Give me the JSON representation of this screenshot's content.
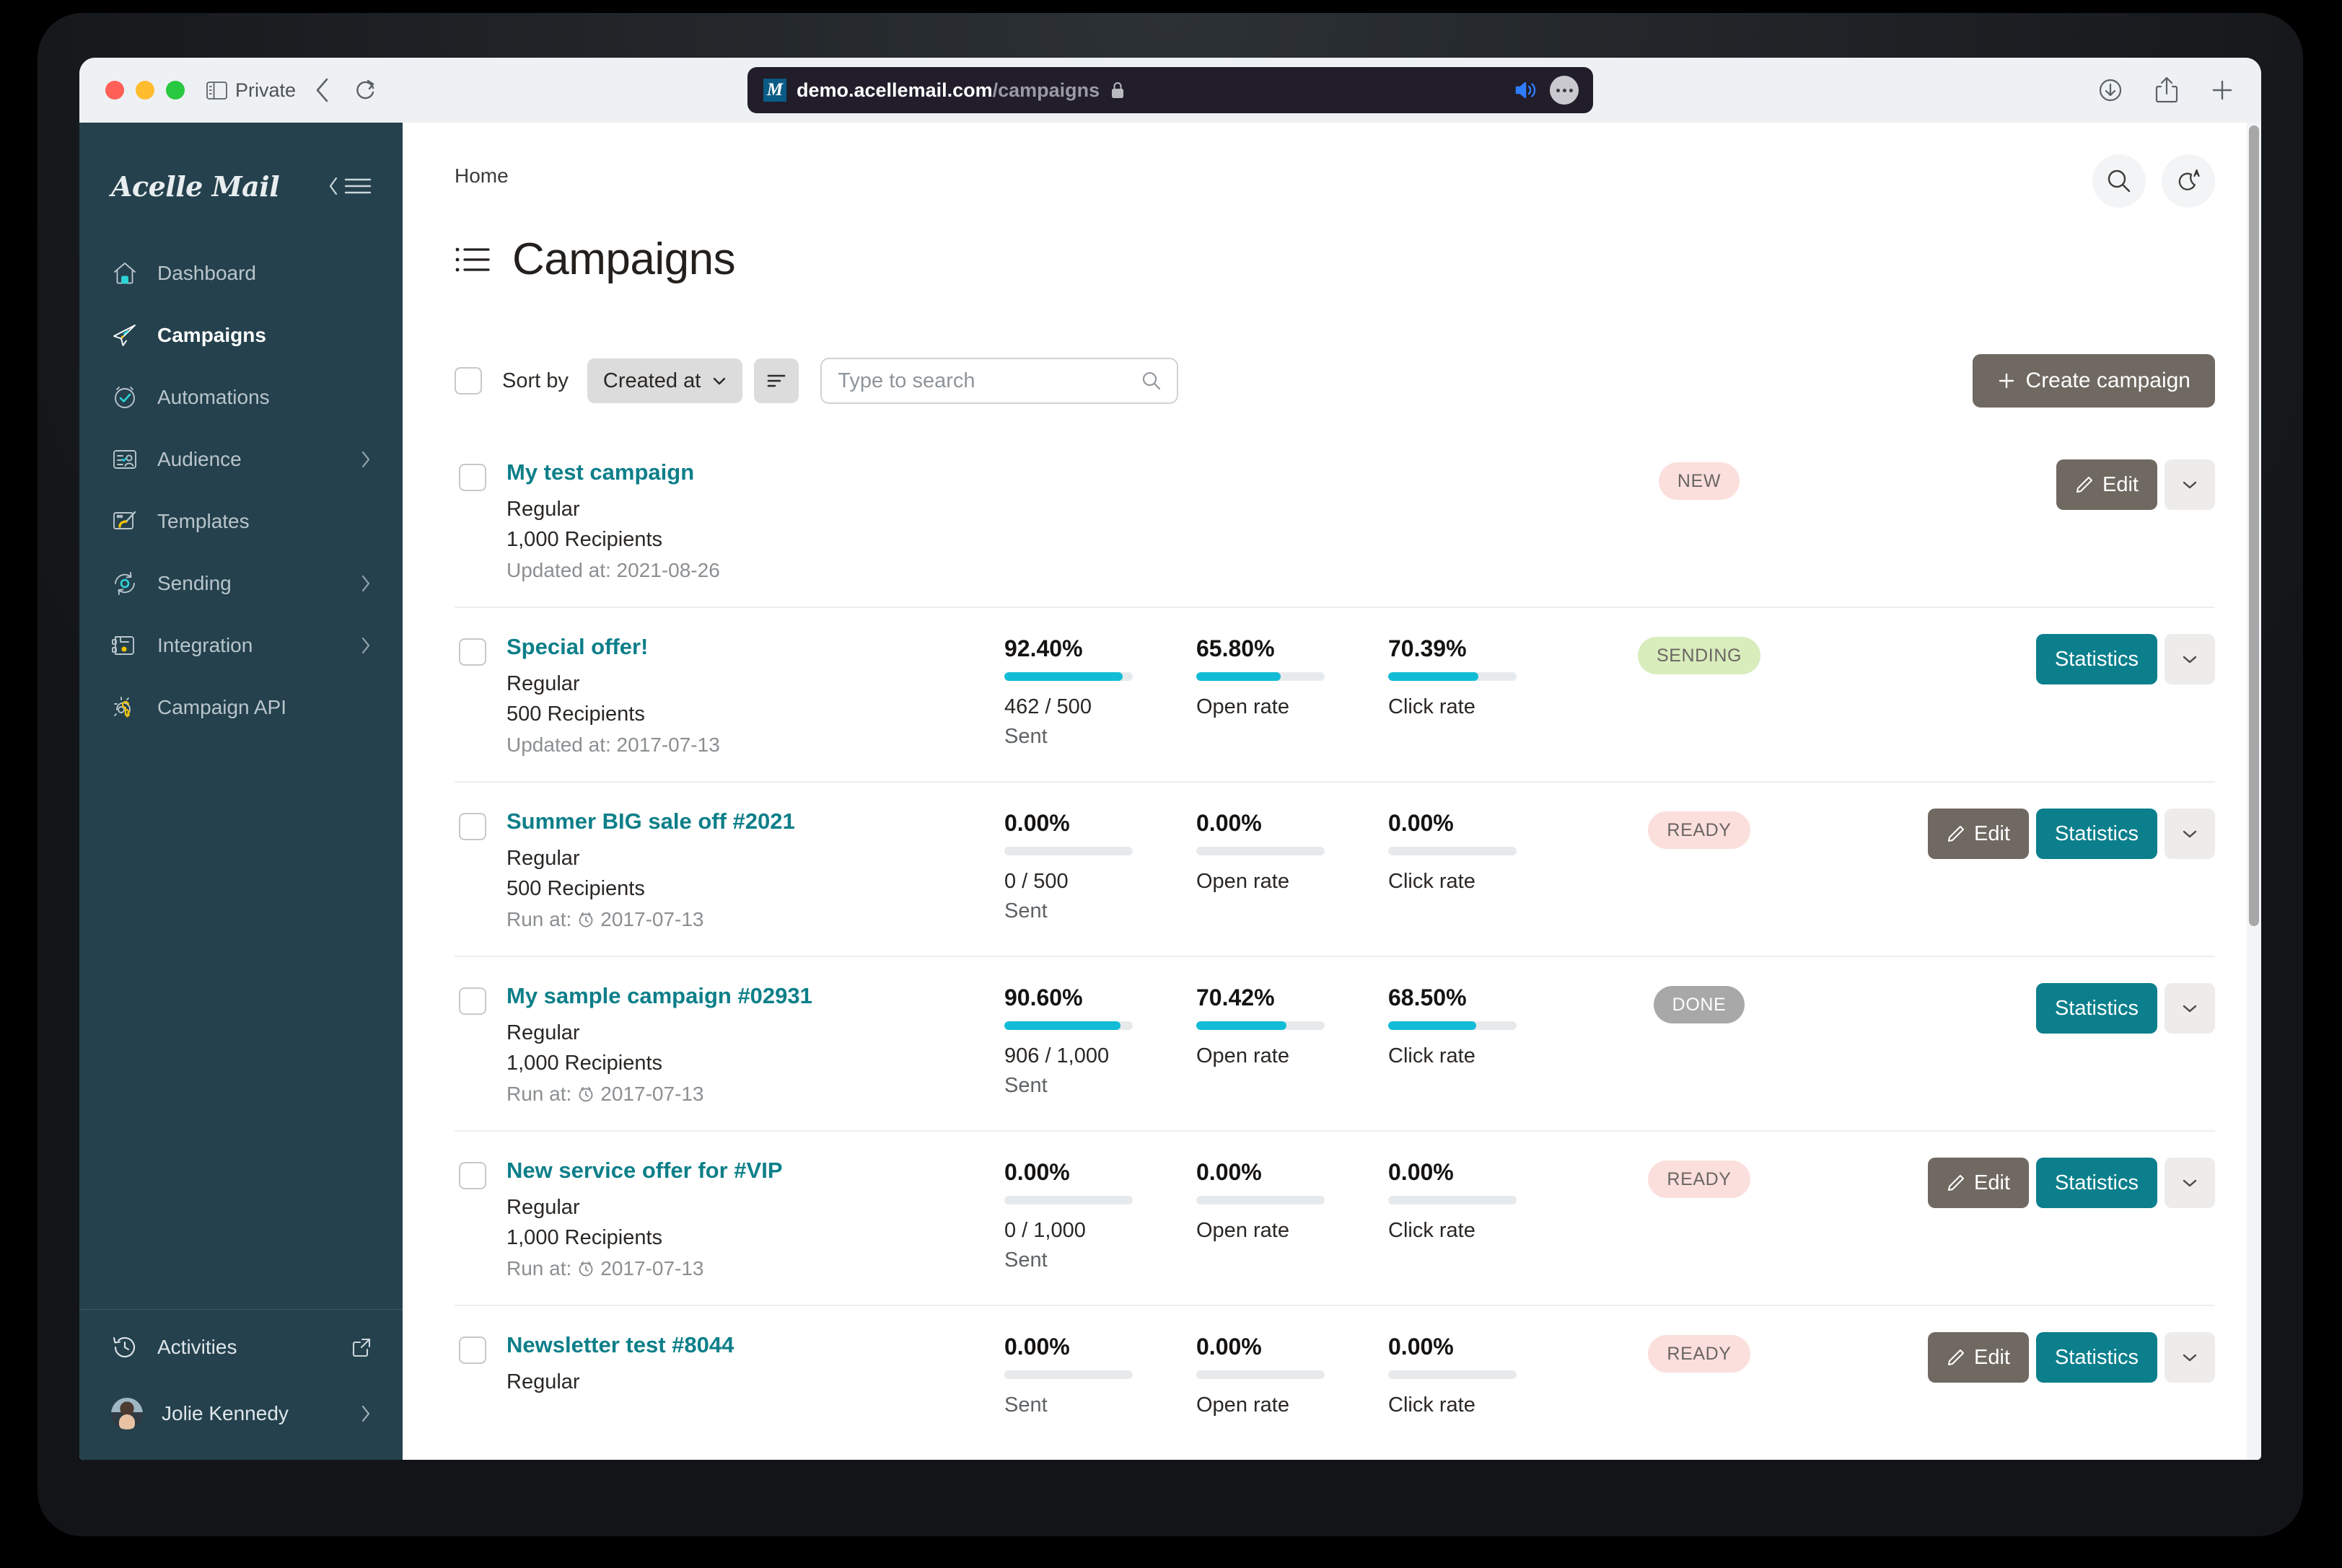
{
  "browser": {
    "private_label": "Private",
    "url_host": "demo.acellemail.com",
    "url_path": "/campaigns",
    "favicon_letter": "M"
  },
  "sidebar": {
    "brand": "Acelle Mail",
    "items": [
      {
        "label": "Dashboard",
        "icon": "home-icon",
        "active": false,
        "chevron": false
      },
      {
        "label": "Campaigns",
        "icon": "paper-plane-icon",
        "active": true,
        "chevron": false
      },
      {
        "label": "Automations",
        "icon": "clock-check-icon",
        "active": false,
        "chevron": false
      },
      {
        "label": "Audience",
        "icon": "contact-card-icon",
        "active": false,
        "chevron": true
      },
      {
        "label": "Templates",
        "icon": "paintbrush-icon",
        "active": false,
        "chevron": false
      },
      {
        "label": "Sending",
        "icon": "sync-gear-icon",
        "active": false,
        "chevron": true
      },
      {
        "label": "Integration",
        "icon": "plug-save-icon",
        "active": false,
        "chevron": true
      },
      {
        "label": "Campaign API",
        "icon": "gear-key-icon",
        "active": false,
        "chevron": false
      }
    ],
    "bottom": {
      "activities_label": "Activities",
      "user_name": "Jolie Kennedy"
    }
  },
  "header": {
    "breadcrumb": "Home",
    "title": "Campaigns",
    "search_icon": "search-icon",
    "theme_icon": "moon-auto-icon"
  },
  "toolbar": {
    "sort_by_label": "Sort by",
    "sort_value": "Created at",
    "sort_options": [
      "Created at"
    ],
    "search_placeholder": "Type to search",
    "search_value": "",
    "create_label": "Create campaign"
  },
  "labels": {
    "sent": "Sent",
    "open_rate": "Open rate",
    "click_rate": "Click rate",
    "edit": "Edit",
    "statistics": "Statistics",
    "recipients_suffix": "Recipients",
    "updated_prefix": "Updated at:",
    "run_prefix": "Run at:"
  },
  "colors": {
    "sidebar_bg": "#24414d",
    "link_teal": "#0d7f89",
    "progress_cyan": "#12bcd6",
    "btn_brown": "#6f6961",
    "btn_teal": "#0b7f8c",
    "badge_pink": "#fbdfdc",
    "badge_green": "#d9ecbc",
    "badge_gray": "#a8a8a8"
  },
  "campaigns": [
    {
      "name": "My test campaign",
      "type": "Regular",
      "recipients": "1,000 Recipients",
      "date_label": "Updated at: 2021-08-26",
      "date_has_clock": false,
      "has_stats": false,
      "sent_pct": "",
      "sent_ratio": "",
      "open_pct": "",
      "click_pct": "",
      "sent_bar": 0,
      "open_bar": 0,
      "click_bar": 0,
      "status": "NEW",
      "status_class": "new",
      "buttons": [
        "edit",
        "caret"
      ]
    },
    {
      "name": "Special offer!",
      "type": "Regular",
      "recipients": "500 Recipients",
      "date_label": "Updated at: 2017-07-13",
      "date_has_clock": false,
      "has_stats": true,
      "sent_pct": "92.40%",
      "sent_ratio": "462 / 500",
      "open_pct": "65.80%",
      "click_pct": "70.39%",
      "sent_bar": 92.4,
      "open_bar": 65.8,
      "click_bar": 70.39,
      "status": "SENDING",
      "status_class": "sending",
      "buttons": [
        "stats",
        "caret"
      ]
    },
    {
      "name": "Summer BIG sale off #2021",
      "type": "Regular",
      "recipients": "500 Recipients",
      "date_label": "Run at: 2017-07-13",
      "date_has_clock": true,
      "has_stats": true,
      "sent_pct": "0.00%",
      "sent_ratio": "0 / 500",
      "open_pct": "0.00%",
      "click_pct": "0.00%",
      "sent_bar": 0,
      "open_bar": 0,
      "click_bar": 0,
      "status": "READY",
      "status_class": "ready",
      "buttons": [
        "edit",
        "stats",
        "caret"
      ]
    },
    {
      "name": "My sample campaign #02931",
      "type": "Regular",
      "recipients": "1,000 Recipients",
      "date_label": "Run at: 2017-07-13",
      "date_has_clock": true,
      "has_stats": true,
      "sent_pct": "90.60%",
      "sent_ratio": "906 / 1,000",
      "open_pct": "70.42%",
      "click_pct": "68.50%",
      "sent_bar": 90.6,
      "open_bar": 70.42,
      "click_bar": 68.5,
      "status": "DONE",
      "status_class": "done",
      "buttons": [
        "stats",
        "caret"
      ]
    },
    {
      "name": "New service offer for #VIP",
      "type": "Regular",
      "recipients": "1,000 Recipients",
      "date_label": "Run at: 2017-07-13",
      "date_has_clock": true,
      "has_stats": true,
      "sent_pct": "0.00%",
      "sent_ratio": "0 / 1,000",
      "open_pct": "0.00%",
      "click_pct": "0.00%",
      "sent_bar": 0,
      "open_bar": 0,
      "click_bar": 0,
      "status": "READY",
      "status_class": "ready",
      "buttons": [
        "edit",
        "stats",
        "caret"
      ]
    },
    {
      "name": "Newsletter test #8044",
      "type": "Regular",
      "recipients": "",
      "date_label": "",
      "date_has_clock": false,
      "has_stats": true,
      "sent_pct": "0.00%",
      "sent_ratio": "",
      "open_pct": "0.00%",
      "click_pct": "0.00%",
      "sent_bar": 0,
      "open_bar": 0,
      "click_bar": 0,
      "status": "READY",
      "status_class": "ready",
      "buttons": [
        "edit",
        "stats",
        "caret"
      ]
    }
  ]
}
